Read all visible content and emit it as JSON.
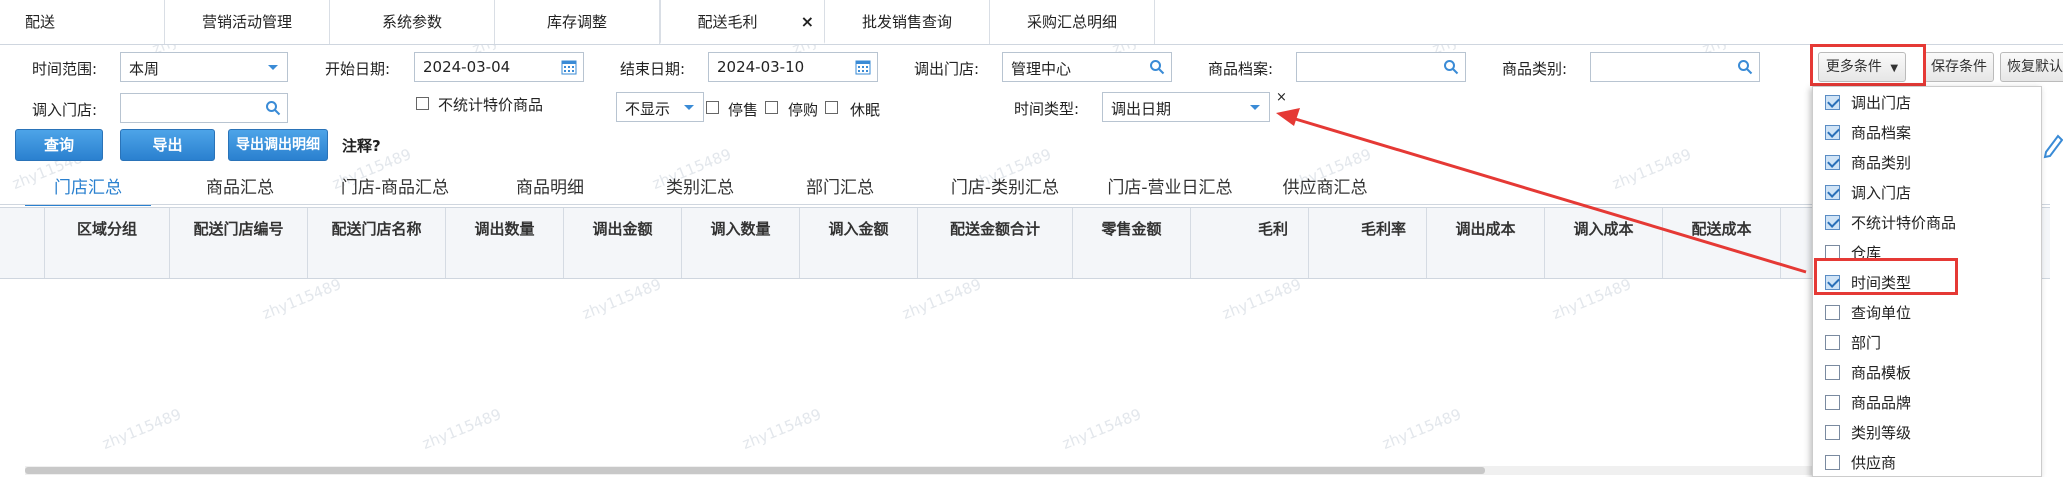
{
  "tabs": [
    {
      "label": "配送"
    },
    {
      "label": "营销活动管理"
    },
    {
      "label": "系统参数"
    },
    {
      "label": "库存调整"
    },
    {
      "label": "配送毛利"
    },
    {
      "label": "批发销售查询"
    },
    {
      "label": "采购汇总明细"
    }
  ],
  "tab_close": "×",
  "watermark": "zhy115489",
  "filters": {
    "time_range_label": "时间范围:",
    "time_range_value": "本周",
    "start_date_label": "开始日期:",
    "start_date_value": "2024-03-04",
    "end_date_label": "结束日期:",
    "end_date_value": "2024-03-10",
    "out_store_label": "调出门店:",
    "out_store_value": "管理中心",
    "product_file_label": "商品档案:",
    "product_category_label": "商品类别:",
    "in_store_label": "调入门店:",
    "no_special_price_label": "不统计特价商品",
    "display_select_value": "不显示",
    "stop_sale_label": "停售",
    "stop_purchase_label": "停购",
    "dormant_label": "休眠",
    "time_type_label": "时间类型:",
    "time_type_value": "调出日期",
    "time_type_remove": "×"
  },
  "toolbar": {
    "more_conditions": "更多条件",
    "save_conditions": "保存条件",
    "restore_default": "恢复默认",
    "query": "查询",
    "export": "导出",
    "export_detail": "导出调出明细",
    "note": "注释?"
  },
  "subtabs": [
    {
      "label": "门店汇总"
    },
    {
      "label": "商品汇总"
    },
    {
      "label": "门店-商品汇总"
    },
    {
      "label": "商品明细"
    },
    {
      "label": "类别汇总"
    },
    {
      "label": "部门汇总"
    },
    {
      "label": "门店-类别汇总"
    },
    {
      "label": "门店-营业日汇总"
    },
    {
      "label": "供应商汇总"
    }
  ],
  "columns": [
    {
      "label": "区域分组"
    },
    {
      "label": "配送门店编号"
    },
    {
      "label": "配送门店名称"
    },
    {
      "label": "调出数量"
    },
    {
      "label": "调出金额"
    },
    {
      "label": "调入数量"
    },
    {
      "label": "调入金额"
    },
    {
      "label": "配送金额合计"
    },
    {
      "label": "零售金额"
    },
    {
      "label": "毛利"
    },
    {
      "label": "毛利率"
    },
    {
      "label": "调出成本"
    },
    {
      "label": "调入成本"
    },
    {
      "label": "配送成本"
    }
  ],
  "more_conditions_menu": [
    {
      "label": "调出门店",
      "checked": true
    },
    {
      "label": "商品档案",
      "checked": true
    },
    {
      "label": "商品类别",
      "checked": true
    },
    {
      "label": "调入门店",
      "checked": true
    },
    {
      "label": "不统计特价商品",
      "checked": true
    },
    {
      "label": "仓库",
      "checked": false
    },
    {
      "label": "时间类型",
      "checked": true
    },
    {
      "label": "查询单位",
      "checked": false
    },
    {
      "label": "部门",
      "checked": false
    },
    {
      "label": "商品模板",
      "checked": false
    },
    {
      "label": "商品品牌",
      "checked": false
    },
    {
      "label": "类别等级",
      "checked": false
    },
    {
      "label": "供应商",
      "checked": false
    }
  ],
  "colors": {
    "accent": "#2a80cf",
    "highlight": "#e53935"
  }
}
